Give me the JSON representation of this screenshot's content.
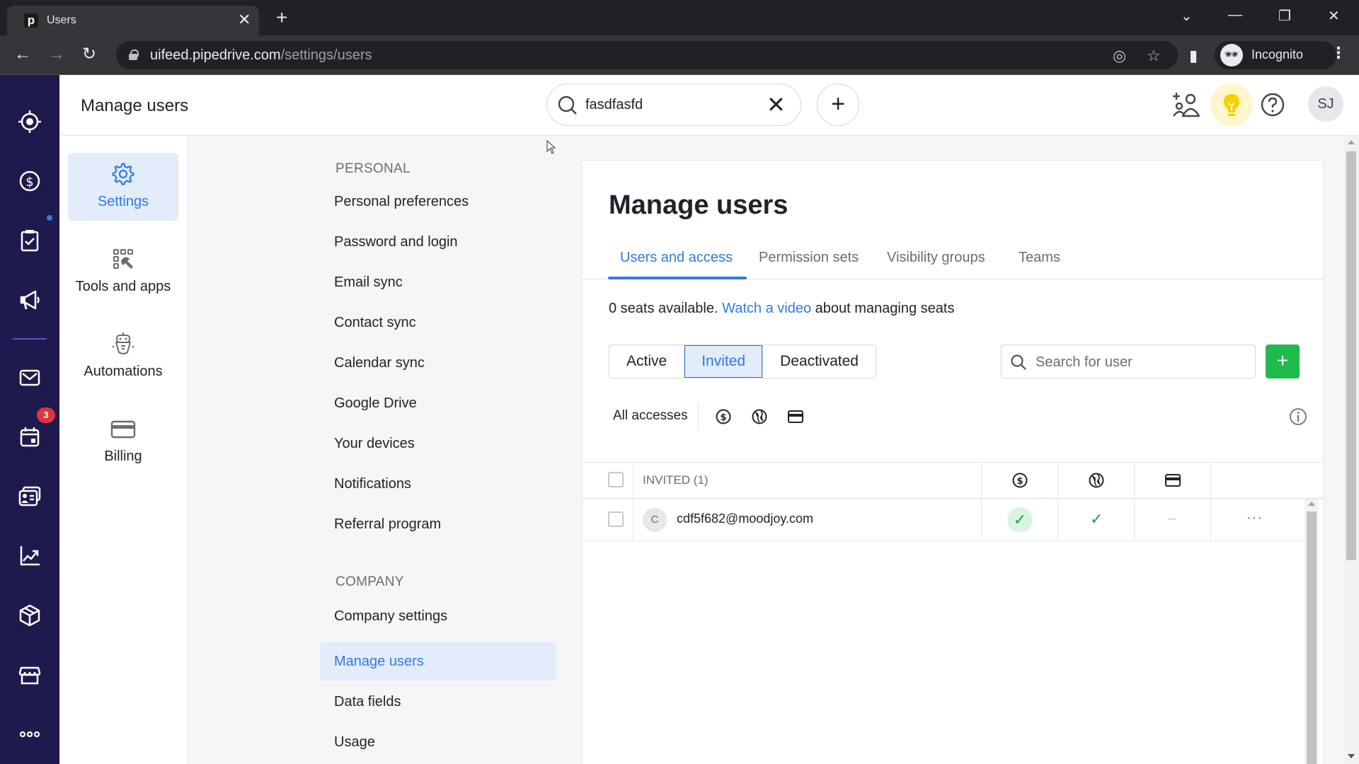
{
  "browser": {
    "tab_title": "Users",
    "tab_favicon": "p",
    "url_host": "uifeed.pipedrive.com",
    "url_path": "/settings/users",
    "profile_label": "Incognito"
  },
  "appbar": {
    "title": "Manage users",
    "search_value": "fasdfasfd",
    "user_initials": "SJ"
  },
  "leftnav": {
    "items": [
      {
        "name": "leads",
        "icon": "target-icon"
      },
      {
        "name": "deals",
        "icon": "dollar-circle-icon"
      },
      {
        "name": "activities",
        "icon": "clipboard-check-icon"
      },
      {
        "name": "campaigns",
        "icon": "megaphone-icon"
      },
      {
        "name": "mail",
        "icon": "envelope-icon"
      },
      {
        "name": "calendar",
        "icon": "calendar-icon"
      },
      {
        "name": "contacts",
        "icon": "contact-card-icon"
      },
      {
        "name": "insights",
        "icon": "trending-chart-icon"
      },
      {
        "name": "products",
        "icon": "box-icon"
      },
      {
        "name": "marketplace",
        "icon": "store-icon"
      },
      {
        "name": "more",
        "icon": "more-dots-icon"
      }
    ],
    "calendar_badge": "3"
  },
  "settings_nav": {
    "items": [
      {
        "label": "Settings",
        "active": true
      },
      {
        "label": "Tools and apps"
      },
      {
        "label": "Automations"
      },
      {
        "label": "Billing"
      }
    ]
  },
  "submenu": {
    "personal_heading": "PERSONAL",
    "personal": [
      "Personal preferences",
      "Password and login",
      "Email sync",
      "Contact sync",
      "Calendar sync",
      "Google Drive",
      "Your devices",
      "Notifications",
      "Referral program"
    ],
    "company_heading": "COMPANY",
    "company": [
      "Company settings",
      "Manage users",
      "Data fields",
      "Usage"
    ],
    "active_item": "Manage users"
  },
  "main": {
    "title": "Manage users",
    "tabs": [
      "Users and access",
      "Permission sets",
      "Visibility groups",
      "Teams"
    ],
    "active_tab": "Users and access",
    "seats_text_before": "0 seats available. ",
    "seats_link": "Watch a video",
    "seats_text_after": " about managing seats",
    "status_filters": [
      "Active",
      "Invited",
      "Deactivated"
    ],
    "active_status": "Invited",
    "user_search_placeholder": "Search for user",
    "access_filter_label": "All accesses",
    "access_icons": [
      "dollar-circle-icon",
      "globe-icon",
      "credit-card-icon"
    ],
    "table": {
      "header_label": "INVITED (1)",
      "columns": [
        "deals-access",
        "campaigns-access",
        "billing-access"
      ],
      "rows": [
        {
          "initial": "C",
          "email": "cdf5f682@moodjoy.com",
          "deals_access": "✓",
          "campaigns_access": "✓",
          "billing_access": "–",
          "actions": "···"
        }
      ]
    }
  },
  "colors": {
    "accent": "#317ae2",
    "nav_bg": "#1e1a4d",
    "success": "#1fbb4b",
    "badge": "#e0343e"
  }
}
